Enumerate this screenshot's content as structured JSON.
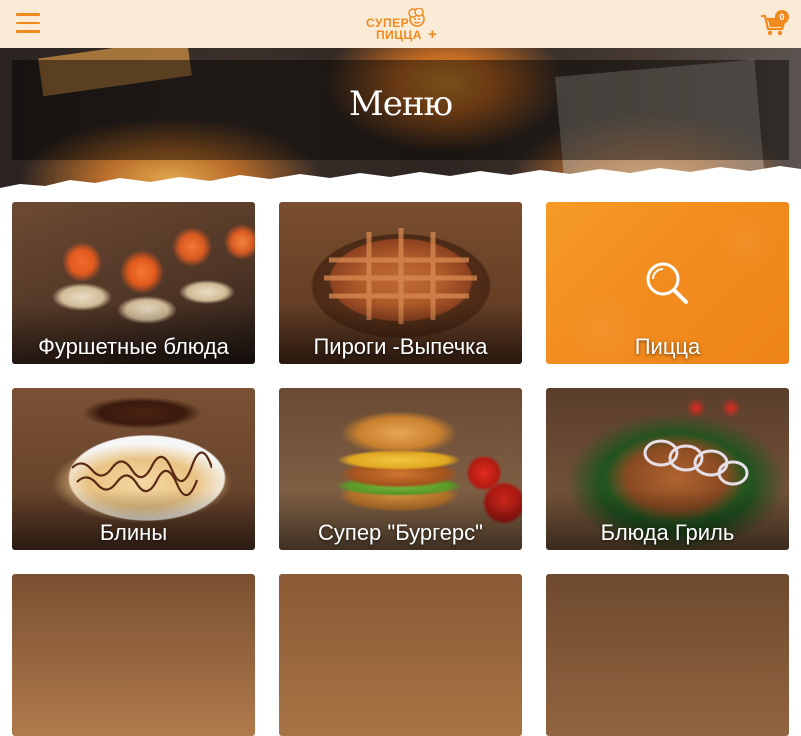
{
  "header": {
    "menu_icon": "hamburger-icon",
    "logo": {
      "line1": "СУПЕР",
      "line2": "ПИЦЦА",
      "plus": "+"
    },
    "cart": {
      "icon": "shopping-cart-icon",
      "count": "0"
    }
  },
  "banner": {
    "title": "Меню"
  },
  "categories": [
    {
      "label": "Фуршетные блюда"
    },
    {
      "label": "Пироги -Выпечка"
    },
    {
      "label": "Пицца",
      "icon": "search-icon"
    },
    {
      "label": "Блины"
    },
    {
      "label": "Супер \"Бургерс\""
    },
    {
      "label": "Блюда Гриль"
    },
    {
      "label": ""
    },
    {
      "label": ""
    },
    {
      "label": ""
    }
  ],
  "colors": {
    "accent": "#f08a1f",
    "header_bg": "#f9ebd6"
  }
}
